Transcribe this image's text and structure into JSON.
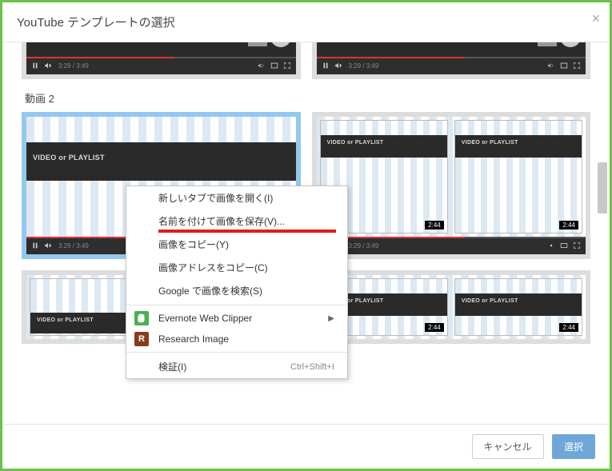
{
  "modal": {
    "title": "YouTube テンプレートの選択",
    "close": "×"
  },
  "sections": {
    "video2": "動画 2"
  },
  "player": {
    "vop_label": "VIDEO or PLAYLIST",
    "time_current": "3:29",
    "time_total": "3:49",
    "time_combined": "3:29 / 3:49",
    "mini_duration": "2:44"
  },
  "footer": {
    "cancel": "キャンセル",
    "select": "選択"
  },
  "context_menu": {
    "items": [
      {
        "label": "新しいタブで画像を開く(I)"
      },
      {
        "label": "名前を付けて画像を保存(V)..."
      },
      {
        "label": "画像をコピー(Y)"
      },
      {
        "label": "画像アドレスをコピー(C)"
      },
      {
        "label": "Google で画像を検索(S)"
      }
    ],
    "ext": [
      {
        "label": "Evernote Web Clipper",
        "icon": "ev",
        "icon_text": "",
        "has_sub": true
      },
      {
        "label": "Research Image",
        "icon": "ri",
        "icon_text": "R"
      }
    ],
    "inspect": {
      "label": "検証(I)",
      "shortcut": "Ctrl+Shift+I"
    }
  }
}
